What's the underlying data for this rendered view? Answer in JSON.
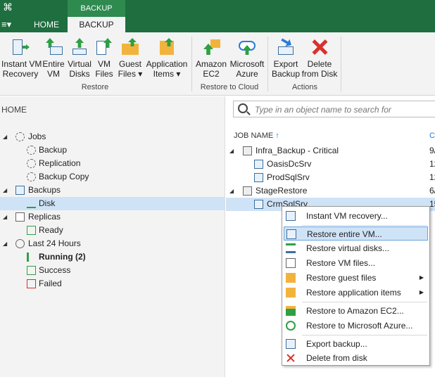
{
  "topbar": {
    "context_tab": "BACKUP TOOLS",
    "tabs": [
      {
        "label": "HOME"
      },
      {
        "label": "BACKUP"
      }
    ],
    "menu_icon": "≡▾",
    "logo_icon": "⌘"
  },
  "ribbon": {
    "groups": [
      {
        "label": "Restore",
        "buttons": [
          {
            "label": "Instant VM\nRecovery",
            "icon": "instant-vm-recovery-icon"
          },
          {
            "label": "Entire\nVM",
            "icon": "entire-vm-icon"
          },
          {
            "label": "Virtual\nDisks",
            "icon": "virtual-disks-icon"
          },
          {
            "label": "VM\nFiles",
            "icon": "vm-files-icon"
          },
          {
            "label": "Guest\nFiles ▾",
            "icon": "guest-files-icon"
          },
          {
            "label": "Application\nItems ▾",
            "icon": "application-items-icon"
          }
        ]
      },
      {
        "label": "Restore to Cloud",
        "buttons": [
          {
            "label": "Amazon\nEC2",
            "icon": "amazon-ec2-icon"
          },
          {
            "label": "Microsoft\nAzure",
            "icon": "microsoft-azure-icon"
          }
        ]
      },
      {
        "label": "Actions",
        "buttons": [
          {
            "label": "Export\nBackup",
            "icon": "export-backup-icon"
          },
          {
            "label": "Delete\nfrom Disk",
            "icon": "delete-icon"
          }
        ]
      }
    ]
  },
  "left": {
    "header": "HOME",
    "tree": [
      {
        "label": "Jobs"
      },
      {
        "label": "Backup"
      },
      {
        "label": "Replication"
      },
      {
        "label": "Backup Copy"
      },
      {
        "label": "Backups"
      },
      {
        "label": "Disk"
      },
      {
        "label": "Replicas"
      },
      {
        "label": "Ready"
      },
      {
        "label": "Last 24 Hours"
      },
      {
        "label": "Running (2)"
      },
      {
        "label": "Success"
      },
      {
        "label": "Failed"
      }
    ]
  },
  "right": {
    "search_placeholder": "Type in an object name to search for",
    "col_job": "JOB NAME",
    "col_job_sort": "↑",
    "col_second": "C",
    "rows": [
      {
        "name": "Infra_Backup - Critical",
        "value": "9/"
      },
      {
        "name": "OasisDcSrv",
        "value": "12"
      },
      {
        "name": "ProdSqlSrv",
        "value": "12"
      },
      {
        "name": "StageRestore",
        "value": "6/"
      },
      {
        "name": "CrmSqlSrv",
        "value": "15"
      }
    ]
  },
  "context_menu": {
    "items": [
      {
        "label": "Instant VM recovery..."
      },
      {
        "label": "Restore entire VM..."
      },
      {
        "label": "Restore virtual disks..."
      },
      {
        "label": "Restore VM files..."
      },
      {
        "label": "Restore guest files"
      },
      {
        "label": "Restore application items"
      },
      {
        "label": "Restore to Amazon EC2..."
      },
      {
        "label": "Restore to Microsoft Azure..."
      },
      {
        "label": "Export backup..."
      },
      {
        "label": "Delete from disk"
      }
    ],
    "submenu_arrow": "▶"
  },
  "colors": {
    "accent": "#1e6e3f",
    "selection": "#cfe3f7",
    "highlight_border": "#6aa3dc"
  }
}
